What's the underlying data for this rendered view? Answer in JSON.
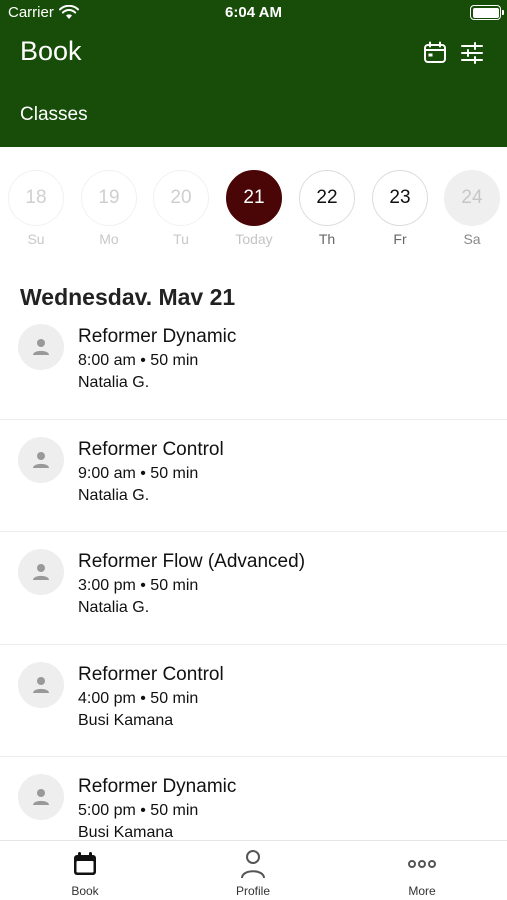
{
  "status_bar": {
    "carrier": "Carrier",
    "time": "6:04 AM"
  },
  "header": {
    "title": "Book",
    "section": "Classes",
    "icons": [
      "calendar-icon",
      "filter-icon"
    ],
    "background": "#174d09"
  },
  "date_strip": {
    "days": [
      {
        "number": "18",
        "label": "Su",
        "state": "past"
      },
      {
        "number": "19",
        "label": "Mo",
        "state": "past"
      },
      {
        "number": "20",
        "label": "Tu",
        "state": "past"
      },
      {
        "number": "21",
        "label": "Today",
        "state": "selected"
      },
      {
        "number": "22",
        "label": "Th",
        "state": "future"
      },
      {
        "number": "23",
        "label": "Fr",
        "state": "future"
      },
      {
        "number": "24",
        "label": "Sa",
        "state": "disabled"
      }
    ],
    "selected_color": "#4a0606"
  },
  "date_heading": "Wednesdav. Mav 21",
  "classes": [
    {
      "name": "Reformer Dynamic",
      "time": "8:00 am • 50 min",
      "instructor": "Natalia G."
    },
    {
      "name": "Reformer Control",
      "time": "9:00 am • 50 min",
      "instructor": "Natalia G."
    },
    {
      "name": "Reformer Flow (Advanced)",
      "time": "3:00 pm • 50 min",
      "instructor": "Natalia G."
    },
    {
      "name": "Reformer Control",
      "time": "4:00 pm • 50 min",
      "instructor": "Busi Kamana"
    },
    {
      "name": "Reformer Dynamic",
      "time": "5:00 pm • 50 min",
      "instructor": "Busi Kamana"
    }
  ],
  "tab_bar": {
    "tabs": [
      {
        "label": "Book",
        "icon": "calendar-icon"
      },
      {
        "label": "Profile",
        "icon": "person-icon"
      },
      {
        "label": "More",
        "icon": "more-icon"
      }
    ]
  }
}
